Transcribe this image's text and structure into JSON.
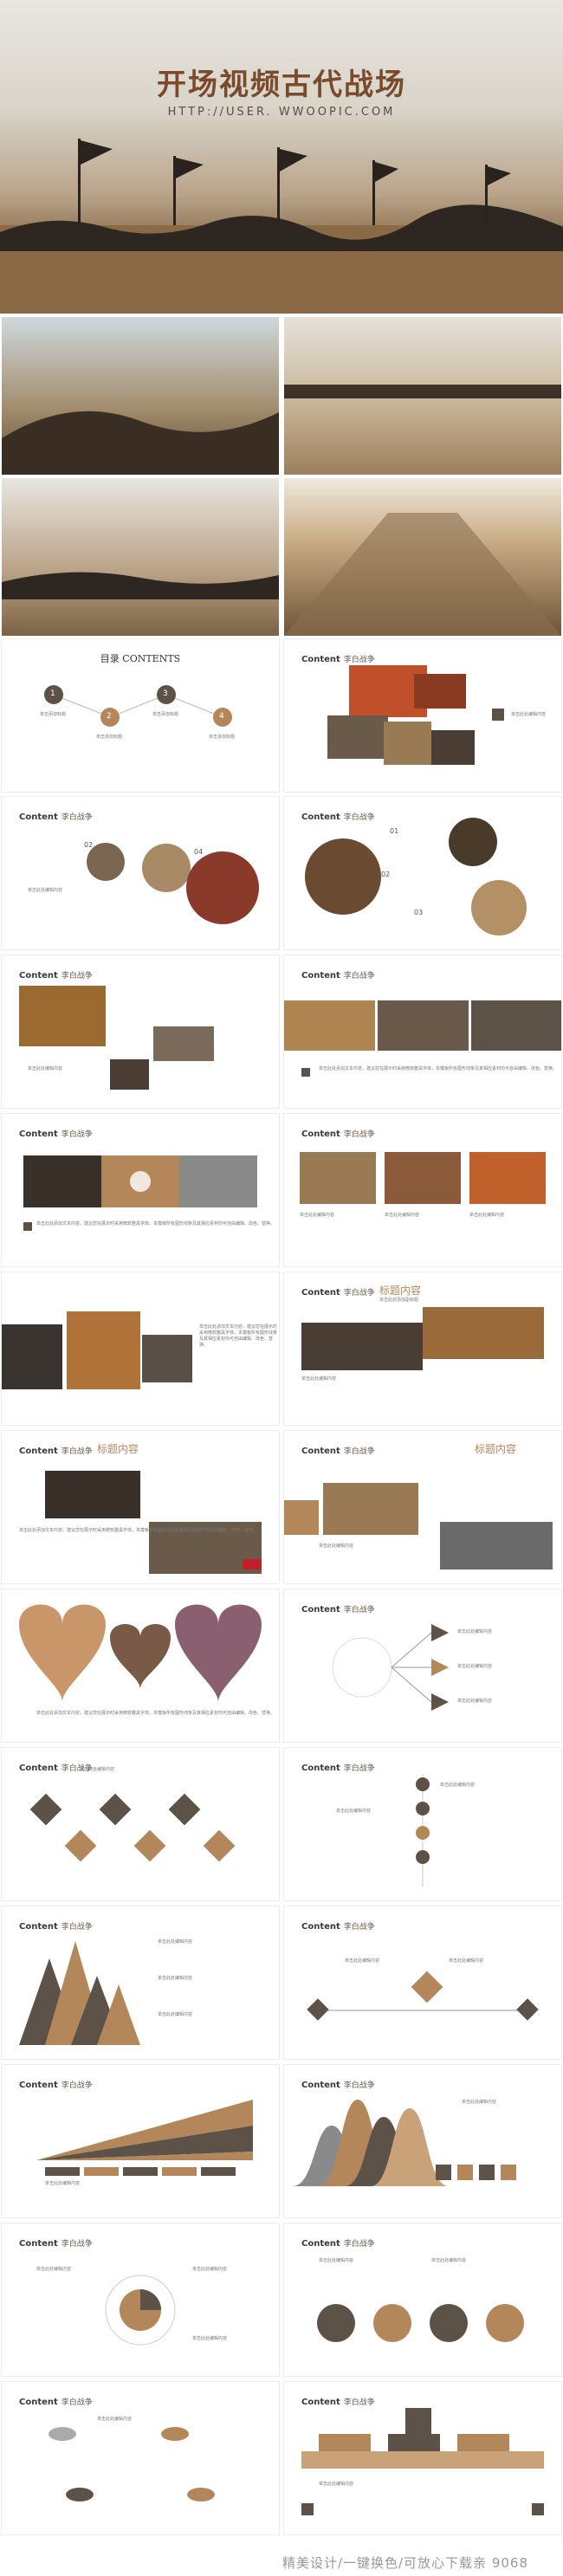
{
  "hero": {
    "title": "开场视频古代战场",
    "url": "HTTP://USER. WWOOPIC.COM"
  },
  "agenda": {
    "title": "目录 CONTENTS",
    "items": [
      {
        "num": "1",
        "label": "单击添加标题"
      },
      {
        "num": "2",
        "label": "单击添加标题"
      },
      {
        "num": "3",
        "label": "单击添加标题"
      },
      {
        "num": "4",
        "label": "单击添加标题"
      }
    ]
  },
  "slide_title": {
    "main": "Content",
    "sub": "李白战争"
  },
  "placeholder_text": "单击此处编辑内容",
  "body_text": "单击此处添加文本内容，建议您在展示时采用微软雅黑字体，本模板所有图形线条及其相应素材均可自由编辑、改色、替换。",
  "heading_block": {
    "title": "标题内容",
    "subtitle": "单击此处添加副标题"
  },
  "numbers": [
    "01",
    "02",
    "03",
    "04"
  ],
  "footer": {
    "text": "精美设计/一键换色/可放心下载亲 9068"
  }
}
